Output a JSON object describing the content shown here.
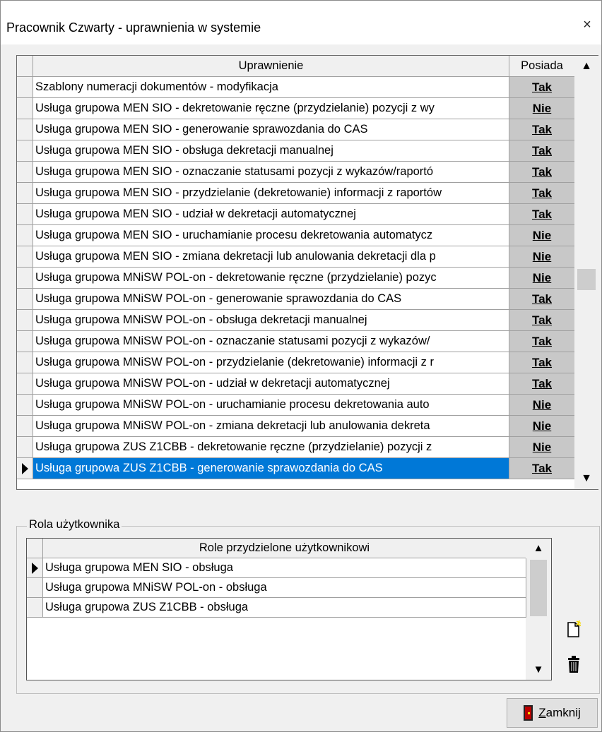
{
  "window": {
    "title": "Pracownik Czwarty - uprawnienia w systemie",
    "close_symbol": "×"
  },
  "permissions_grid": {
    "headers": {
      "permission": "Uprawnienie",
      "has": "Posiada"
    },
    "rows": [
      {
        "name": "Szablony numeracji dokumentów - modyfikacja",
        "has": "Tak"
      },
      {
        "name": "Usługa grupowa MEN SIO - dekretowanie ręczne (przydzielanie) pozycji z wy",
        "has": "Nie"
      },
      {
        "name": "Usługa grupowa MEN SIO - generowanie sprawozdania do CAS",
        "has": "Tak"
      },
      {
        "name": "Usługa grupowa MEN SIO - obsługa dekretacji manualnej",
        "has": "Tak"
      },
      {
        "name": "Usługa grupowa MEN SIO - oznaczanie statusami pozycji z wykazów/raportó",
        "has": "Tak"
      },
      {
        "name": "Usługa grupowa MEN SIO - przydzielanie (dekretowanie) informacji z raportów",
        "has": "Tak"
      },
      {
        "name": "Usługa grupowa MEN SIO - udział w dekretacji automatycznej",
        "has": "Tak"
      },
      {
        "name": "Usługa grupowa MEN SIO - uruchamianie procesu dekretowania automatycz",
        "has": "Nie"
      },
      {
        "name": "Usługa grupowa MEN SIO - zmiana dekretacji lub anulowania dekretacji dla p",
        "has": "Nie"
      },
      {
        "name": "Usługa grupowa MNiSW POL-on - dekretowanie ręczne (przydzielanie) pozyc",
        "has": "Nie"
      },
      {
        "name": "Usługa grupowa MNiSW POL-on - generowanie sprawozdania do CAS",
        "has": "Tak"
      },
      {
        "name": "Usługa grupowa MNiSW POL-on - obsługa dekretacji manualnej",
        "has": "Tak"
      },
      {
        "name": "Usługa grupowa MNiSW POL-on - oznaczanie statusami pozycji z wykazów/",
        "has": "Tak"
      },
      {
        "name": "Usługa grupowa MNiSW POL-on - przydzielanie (dekretowanie) informacji z r",
        "has": "Tak"
      },
      {
        "name": "Usługa grupowa MNiSW POL-on - udział w dekretacji automatycznej",
        "has": "Tak"
      },
      {
        "name": "Usługa grupowa MNiSW POL-on - uruchamianie procesu dekretowania auto",
        "has": "Nie"
      },
      {
        "name": "Usługa grupowa MNiSW POL-on - zmiana dekretacji lub anulowania dekreta",
        "has": "Nie"
      },
      {
        "name": "Usługa grupowa ZUS Z1CBB - dekretowanie ręczne (przydzielanie) pozycji z",
        "has": "Nie"
      },
      {
        "name": "Usługa grupowa ZUS Z1CBB - generowanie sprawozdania do CAS",
        "has": "Tak",
        "selected": true
      }
    ],
    "scroll": {
      "up": "^",
      "down": "v"
    }
  },
  "role_group": {
    "label": "Rola użytkownika",
    "header": "Role przydzielone użytkownikowi",
    "rows": [
      "Usługa grupowa MEN SIO - obsługa",
      "Usługa grupowa MNiSW POL-on - obsługa",
      "Usługa grupowa ZUS Z1CBB - obsługa"
    ],
    "scroll": {
      "up": "^",
      "down": "v"
    }
  },
  "buttons": {
    "close_prefix": "Z",
    "close_rest": "amknij"
  },
  "colors": {
    "selection": "#0078d7",
    "posiada_cell": "#c8c8c8",
    "background": "#f0f0f0"
  }
}
